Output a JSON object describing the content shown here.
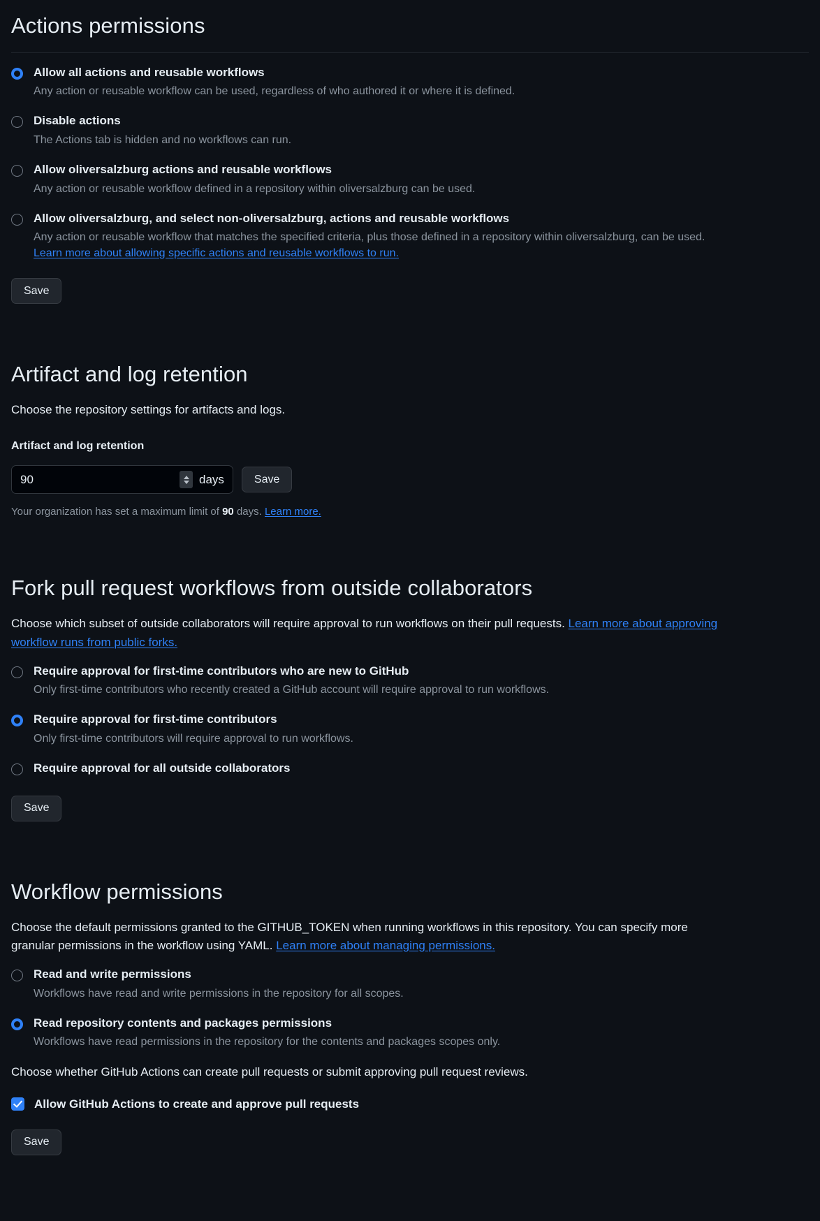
{
  "actions_permissions": {
    "title": "Actions permissions",
    "options": [
      {
        "label": "Allow all actions and reusable workflows",
        "help": "Any action or reusable workflow can be used, regardless of who authored it or where it is defined.",
        "selected": true
      },
      {
        "label": "Disable actions",
        "help": "The Actions tab is hidden and no workflows can run.",
        "selected": false
      },
      {
        "label": "Allow oliversalzburg actions and reusable workflows",
        "help": "Any action or reusable workflow defined in a repository within oliversalzburg can be used.",
        "selected": false
      },
      {
        "label": "Allow oliversalzburg, and select non-oliversalzburg, actions and reusable workflows",
        "help": "Any action or reusable workflow that matches the specified criteria, plus those defined in a repository within oliversalzburg, can be used.",
        "selected": false,
        "link": "Learn more about allowing specific actions and reusable workflows to run."
      }
    ],
    "save_label": "Save"
  },
  "artifact_retention": {
    "title": "Artifact and log retention",
    "description": "Choose the repository settings for artifacts and logs.",
    "field_label": "Artifact and log retention",
    "value": "90",
    "unit": "days",
    "save_label": "Save",
    "note_prefix": "Your organization has set a maximum limit of ",
    "note_value": "90",
    "note_suffix": " days. ",
    "note_link": "Learn more."
  },
  "fork_pr": {
    "title": "Fork pull request workflows from outside collaborators",
    "description": "Choose which subset of outside collaborators will require approval to run workflows on their pull requests. ",
    "description_link": "Learn more about approving workflow runs from public forks.",
    "options": [
      {
        "label": "Require approval for first-time contributors who are new to GitHub",
        "help": "Only first-time contributors who recently created a GitHub account will require approval to run workflows.",
        "selected": false
      },
      {
        "label": "Require approval for first-time contributors",
        "help": "Only first-time contributors will require approval to run workflows.",
        "selected": true
      },
      {
        "label": "Require approval for all outside collaborators",
        "help": "",
        "selected": false
      }
    ],
    "save_label": "Save"
  },
  "workflow_permissions": {
    "title": "Workflow permissions",
    "description": "Choose the default permissions granted to the GITHUB_TOKEN when running workflows in this repository. You can specify more granular permissions in the workflow using YAML. ",
    "description_link": "Learn more about managing permissions.",
    "options": [
      {
        "label": "Read and write permissions",
        "help": "Workflows have read and write permissions in the repository for all scopes.",
        "selected": false
      },
      {
        "label": "Read repository contents and packages permissions",
        "help": "Workflows have read permissions in the repository for the contents and packages scopes only.",
        "selected": true
      }
    ],
    "checkbox_description": "Choose whether GitHub Actions can create pull requests or submit approving pull request reviews.",
    "checkbox_label": "Allow GitHub Actions to create and approve pull requests",
    "checkbox_checked": true,
    "save_label": "Save"
  },
  "colors": {
    "background": "#0d1117",
    "accent": "#2f81f7",
    "text": "#e6edf3",
    "muted": "#8b949e",
    "button": "#21262d"
  }
}
